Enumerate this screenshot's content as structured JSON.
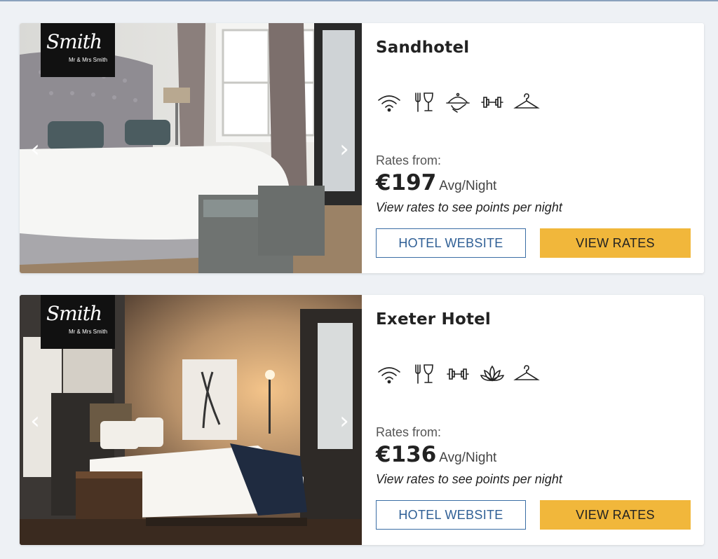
{
  "hotels": [
    {
      "name": "Sandhotel",
      "brand": {
        "script": "Smith",
        "tagline": "Mr & Mrs Smith"
      },
      "amenities": [
        "wifi-icon",
        "restaurant-bar-icon",
        "room-service-icon",
        "gym-icon",
        "hanger-icon"
      ],
      "rates_label": "Rates from:",
      "price": "€197",
      "price_unit": "Avg/Night",
      "points_note": "View rates to see points per night",
      "website_label": "HOTEL WEBSITE",
      "view_rates_label": "VIEW RATES",
      "prev_glyph": "‹",
      "next_glyph": "›"
    },
    {
      "name": "Exeter Hotel",
      "brand": {
        "script": "Smith",
        "tagline": "Mr & Mrs Smith"
      },
      "amenities": [
        "wifi-icon",
        "restaurant-bar-icon",
        "gym-icon",
        "spa-lotus-icon",
        "hanger-icon"
      ],
      "rates_label": "Rates from:",
      "price": "€136",
      "price_unit": "Avg/Night",
      "points_note": "View rates to see points per night",
      "website_label": "HOTEL WEBSITE",
      "view_rates_label": "VIEW RATES",
      "prev_glyph": "‹",
      "next_glyph": "›"
    }
  ],
  "colors": {
    "background": "#eef1f5",
    "button_primary": "#f1b73b",
    "button_outline": "#3b6ea5"
  }
}
